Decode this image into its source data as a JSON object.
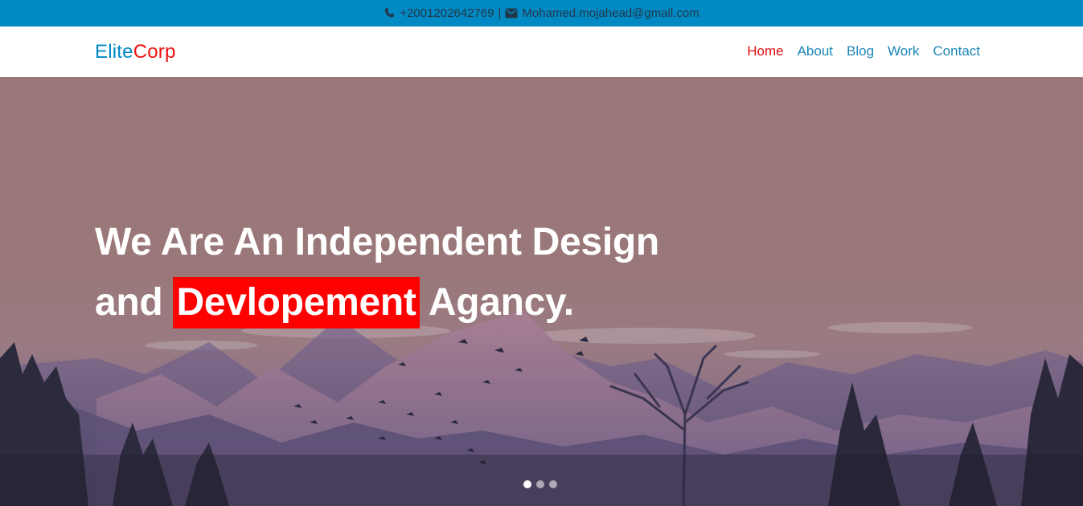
{
  "topbar": {
    "phone": "+2001202642769",
    "separator": "|",
    "email": "Mohamed.mojahead@gmail.com",
    "phone_icon": "phone-icon",
    "email_icon": "envelope-icon"
  },
  "brand": {
    "part1": "Elite",
    "part2": "Corp",
    "color1": "#0189c4",
    "color2": "#ee1111"
  },
  "nav": {
    "items": [
      {
        "label": "Home",
        "active": true
      },
      {
        "label": "About",
        "active": false
      },
      {
        "label": "Blog",
        "active": false
      },
      {
        "label": "Work",
        "active": false
      },
      {
        "label": "Contact",
        "active": false
      }
    ]
  },
  "hero": {
    "line1": "We Are An Independent Design",
    "line2_prefix": "and",
    "line2_highlight": "Devlopement",
    "line2_suffix": "Agancy.",
    "highlight_color": "#ff0000",
    "carousel": {
      "slides": 3,
      "active": 1
    }
  },
  "colors": {
    "topbar": "#0189c4",
    "nav_link": "#1b86b8",
    "nav_active": "#e00f0f"
  }
}
